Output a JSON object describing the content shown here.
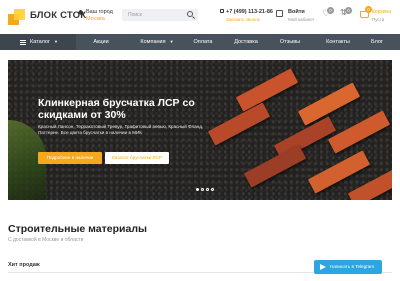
{
  "header": {
    "logo_text": "БЛОК СТОК",
    "city_label": "Ваш город",
    "city_value": "Москва",
    "search_placeholder": "Поиск",
    "phone_number": "+7 (499) 113-21-86",
    "phone_sub": "Заказать звонок",
    "login_title": "Войти",
    "login_sub": "Мой кабинет",
    "favorites_count": "0",
    "compare_count": "0",
    "cart_count": "0",
    "cart_label": "Корзина",
    "cart_sub": "Пуста"
  },
  "nav": {
    "items": [
      "Каталог",
      "Акции",
      "Компания",
      "Оплата",
      "Доставка",
      "Отзывы",
      "Контакты",
      "Блог"
    ]
  },
  "banner": {
    "title": "Клинкерная брусчатка ЛСР со скидками от 30%",
    "description": "Красный Лансон, Терракотовый Тревур, Графитовый вевью, Красный Фланд, Паттерне. Все цвета брусчатки в наличии в МИК",
    "btn_primary": "Подробнее в наличии",
    "btn_secondary": "Каталог брусчатки ЛСР",
    "slides": 4,
    "active_slide": 1
  },
  "section": {
    "title": "Строительные материалы",
    "subtitle": "С доставкой в Москве и области",
    "hits_label": "Хит продаж"
  },
  "telegram_button": "Написать в Telegram",
  "colors": {
    "accent": "#f4a91c",
    "nav_bg": "#48525c",
    "telegram": "#2ca5e0"
  }
}
